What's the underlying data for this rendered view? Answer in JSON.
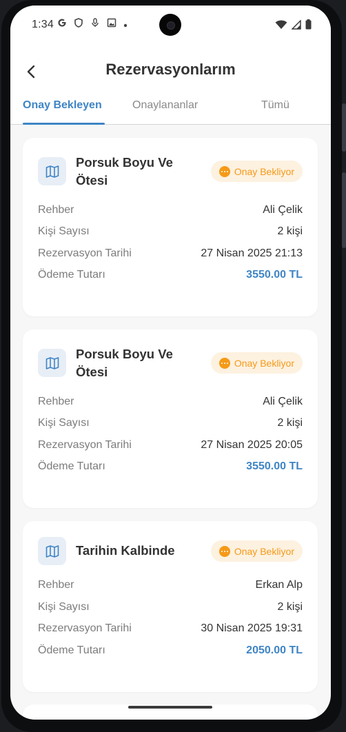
{
  "status_bar": {
    "time": "1:34",
    "left_icons": [
      "google-icon",
      "shield-icon",
      "mic-icon",
      "photo-icon",
      "dot-icon"
    ],
    "right_icons": [
      "wifi-icon",
      "signal-icon",
      "battery-icon"
    ]
  },
  "header": {
    "title": "Rezervasyonlarım",
    "back_icon": "chevron-left-icon"
  },
  "tabs": [
    {
      "label": "Onay Bekleyen",
      "active": true
    },
    {
      "label": "Onaylananlar",
      "active": false
    },
    {
      "label": "Tümü",
      "active": false
    }
  ],
  "colors": {
    "accent": "#3f85c5",
    "pending": "#f59a17",
    "pending_bg": "#fdf1e0",
    "background": "#f7f7f7"
  },
  "reservations": [
    {
      "title": "Porsuk Boyu Ve Ötesi",
      "status": "Onay Bekliyor",
      "rows": [
        {
          "label": "Rehber",
          "value": "Ali Çelik"
        },
        {
          "label": "Kişi Sayısı",
          "value": "2 kişi"
        },
        {
          "label": "Rezervasyon Tarihi",
          "value": "27 Nisan 2025 21:13"
        },
        {
          "label": "Ödeme Tutarı",
          "value": "3550.00 TL"
        }
      ]
    },
    {
      "title": "Porsuk Boyu Ve Ötesi",
      "status": "Onay Bekliyor",
      "rows": [
        {
          "label": "Rehber",
          "value": "Ali Çelik"
        },
        {
          "label": "Kişi Sayısı",
          "value": "2 kişi"
        },
        {
          "label": "Rezervasyon Tarihi",
          "value": "27 Nisan 2025 20:05"
        },
        {
          "label": "Ödeme Tutarı",
          "value": "3550.00 TL"
        }
      ]
    },
    {
      "title": "Tarihin Kalbinde",
      "status": "Onay Bekliyor",
      "rows": [
        {
          "label": "Rehber",
          "value": "Erkan Alp"
        },
        {
          "label": "Kişi Sayısı",
          "value": "2 kişi"
        },
        {
          "label": "Rezervasyon Tarihi",
          "value": "30 Nisan 2025 19:31"
        },
        {
          "label": "Ödeme Tutarı",
          "value": "2050.00 TL"
        }
      ]
    }
  ]
}
